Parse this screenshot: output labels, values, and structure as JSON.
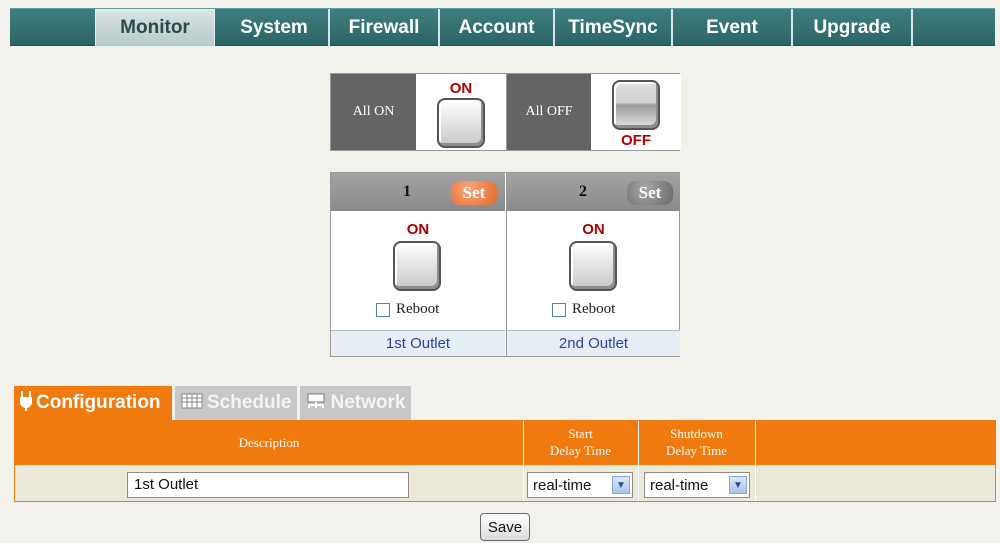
{
  "nav": {
    "tabs": [
      {
        "label": "Monitor",
        "active": true
      },
      {
        "label": "System"
      },
      {
        "label": "Firewall"
      },
      {
        "label": "Account"
      },
      {
        "label": "TimeSync"
      },
      {
        "label": "Event"
      },
      {
        "label": "Upgrade"
      }
    ]
  },
  "all_panel": {
    "all_on_label": "All ON",
    "all_off_label": "All OFF",
    "on_text": "ON",
    "off_text": "OFF"
  },
  "outlets": [
    {
      "number": "1",
      "set_label": "Set",
      "state": "ON",
      "reboot_label": "Reboot",
      "name": "1st Outlet"
    },
    {
      "number": "2",
      "set_label": "Set",
      "state": "ON",
      "reboot_label": "Reboot",
      "name": "2nd Outlet"
    }
  ],
  "subtabs": [
    {
      "label": "Configuration",
      "icon": "plug-icon",
      "active": true
    },
    {
      "label": "Schedule",
      "icon": "calendar-icon"
    },
    {
      "label": "Network",
      "icon": "network-icon"
    }
  ],
  "config_table": {
    "headers": {
      "description": "Description",
      "start_line1": "Start",
      "start_line2": "Delay Time",
      "shutdown_line1": "Shutdown",
      "shutdown_line2": "Delay Time"
    },
    "row": {
      "description": "1st Outlet",
      "start_delay": "real-time",
      "shutdown_delay": "real-time"
    }
  },
  "save_label": "Save",
  "colors": {
    "nav_bg": "#2e6b6b",
    "accent_orange": "#f07a0e",
    "on_red": "#b00000",
    "link_blue": "#2c3fa8"
  }
}
